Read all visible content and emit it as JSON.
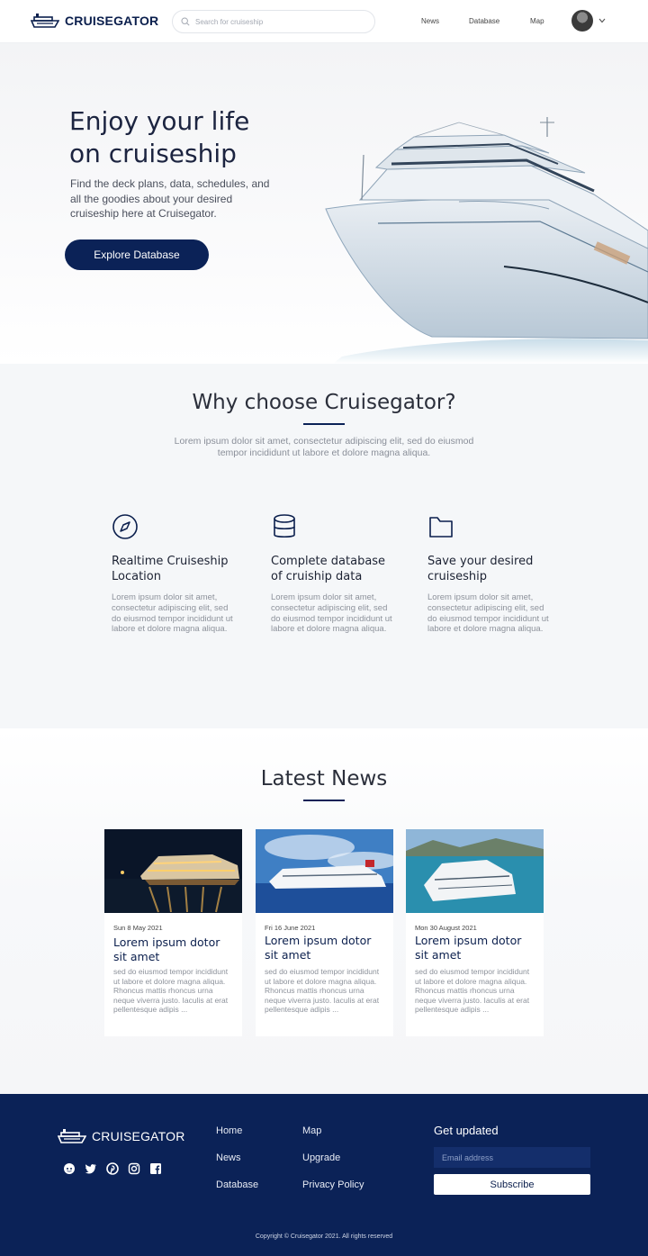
{
  "header": {
    "brand": "CRUISEGATOR",
    "search_placeholder": "Search for cruiseship",
    "nav": [
      "News",
      "Database",
      "Map"
    ]
  },
  "hero": {
    "title_line1": "Enjoy your life",
    "title_line2": "on cruiseship",
    "description": "Find the deck plans, data, schedules, and all the goodies about your desired cruiseship here at Cruisegator.",
    "cta": "Explore Database"
  },
  "why": {
    "title": "Why choose Cruisegator?",
    "subtitle": "Lorem ipsum dolor sit amet, consectetur adipiscing elit, sed do eiusmod tempor incididunt ut labore et dolore magna aliqua.",
    "features": [
      {
        "icon": "compass-icon",
        "title": "Realtime Cruiseship Location",
        "text": "Lorem ipsum dolor sit amet, consectetur adipiscing elit, sed do eiusmod tempor incididunt ut labore et dolore magna aliqua."
      },
      {
        "icon": "database-icon",
        "title": "Complete database of cruiship data",
        "text": "Lorem ipsum dolor sit amet, consectetur adipiscing elit, sed do eiusmod tempor incididunt ut labore et dolore magna aliqua."
      },
      {
        "icon": "folder-icon",
        "title": "Save your desired cruiseship",
        "text": "Lorem ipsum dolor sit amet, consectetur adipiscing elit, sed do eiusmod tempor incididunt ut labore et dolore magna aliqua."
      }
    ]
  },
  "news": {
    "title": "Latest News",
    "cards": [
      {
        "date": "Sun 8 May 2021",
        "title": "Lorem ipsum dotor sit amet",
        "text": "sed do eiusmod tempor incididunt ut labore et dolore magna aliqua. Rhoncus mattis rhoncus urna neque viverra justo. Iaculis at erat pellentesque adipis ..."
      },
      {
        "date": "Fri 16 June 2021",
        "title": "Lorem ipsum dotor sit amet",
        "text": "sed do eiusmod tempor incididunt ut labore et dolore magna aliqua. Rhoncus mattis rhoncus urna neque viverra justo. Iaculis at erat pellentesque adipis ..."
      },
      {
        "date": "Mon 30 August 2021",
        "title": "Lorem ipsum dotor sit amet",
        "text": "sed do eiusmod tempor incididunt ut labore et dolore magna aliqua. Rhoncus mattis rhoncus urna neque viverra justo. Iaculis at erat pellentesque adipis ..."
      }
    ]
  },
  "footer": {
    "brand": "CRUISEGATOR",
    "social": [
      "reddit-icon",
      "twitter-icon",
      "pinterest-icon",
      "instagram-icon",
      "facebook-icon"
    ],
    "links_col1": [
      "Home",
      "News",
      "Database"
    ],
    "links_col2": [
      "Map",
      "Upgrade",
      "Privacy Policy"
    ],
    "newsletter_title": "Get updated",
    "email_placeholder": "Email address",
    "subscribe": "Subscribe",
    "copyright": "Copyright © Cruisegator 2021. All rights reserved"
  },
  "colors": {
    "primary": "#0b2257",
    "section_bg": "#f5f7f9"
  }
}
